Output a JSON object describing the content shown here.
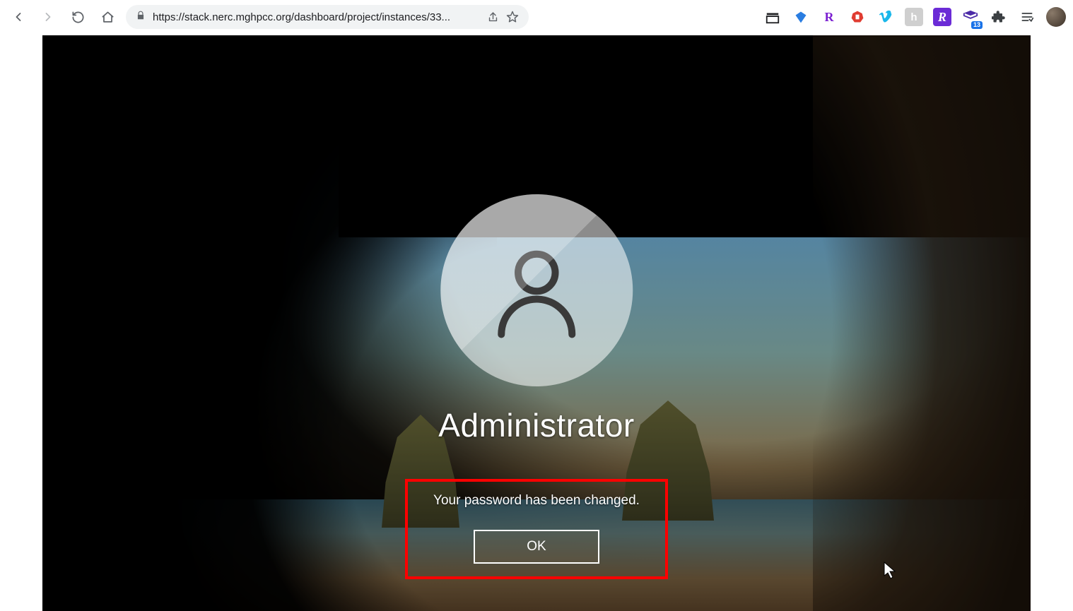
{
  "browser": {
    "url": "https://stack.nerc.mghpcc.org/dashboard/project/instances/33...",
    "extensions_badge": "13"
  },
  "lockscreen": {
    "username": "Administrator",
    "message": "Your password has been changed.",
    "ok_label": "OK"
  }
}
